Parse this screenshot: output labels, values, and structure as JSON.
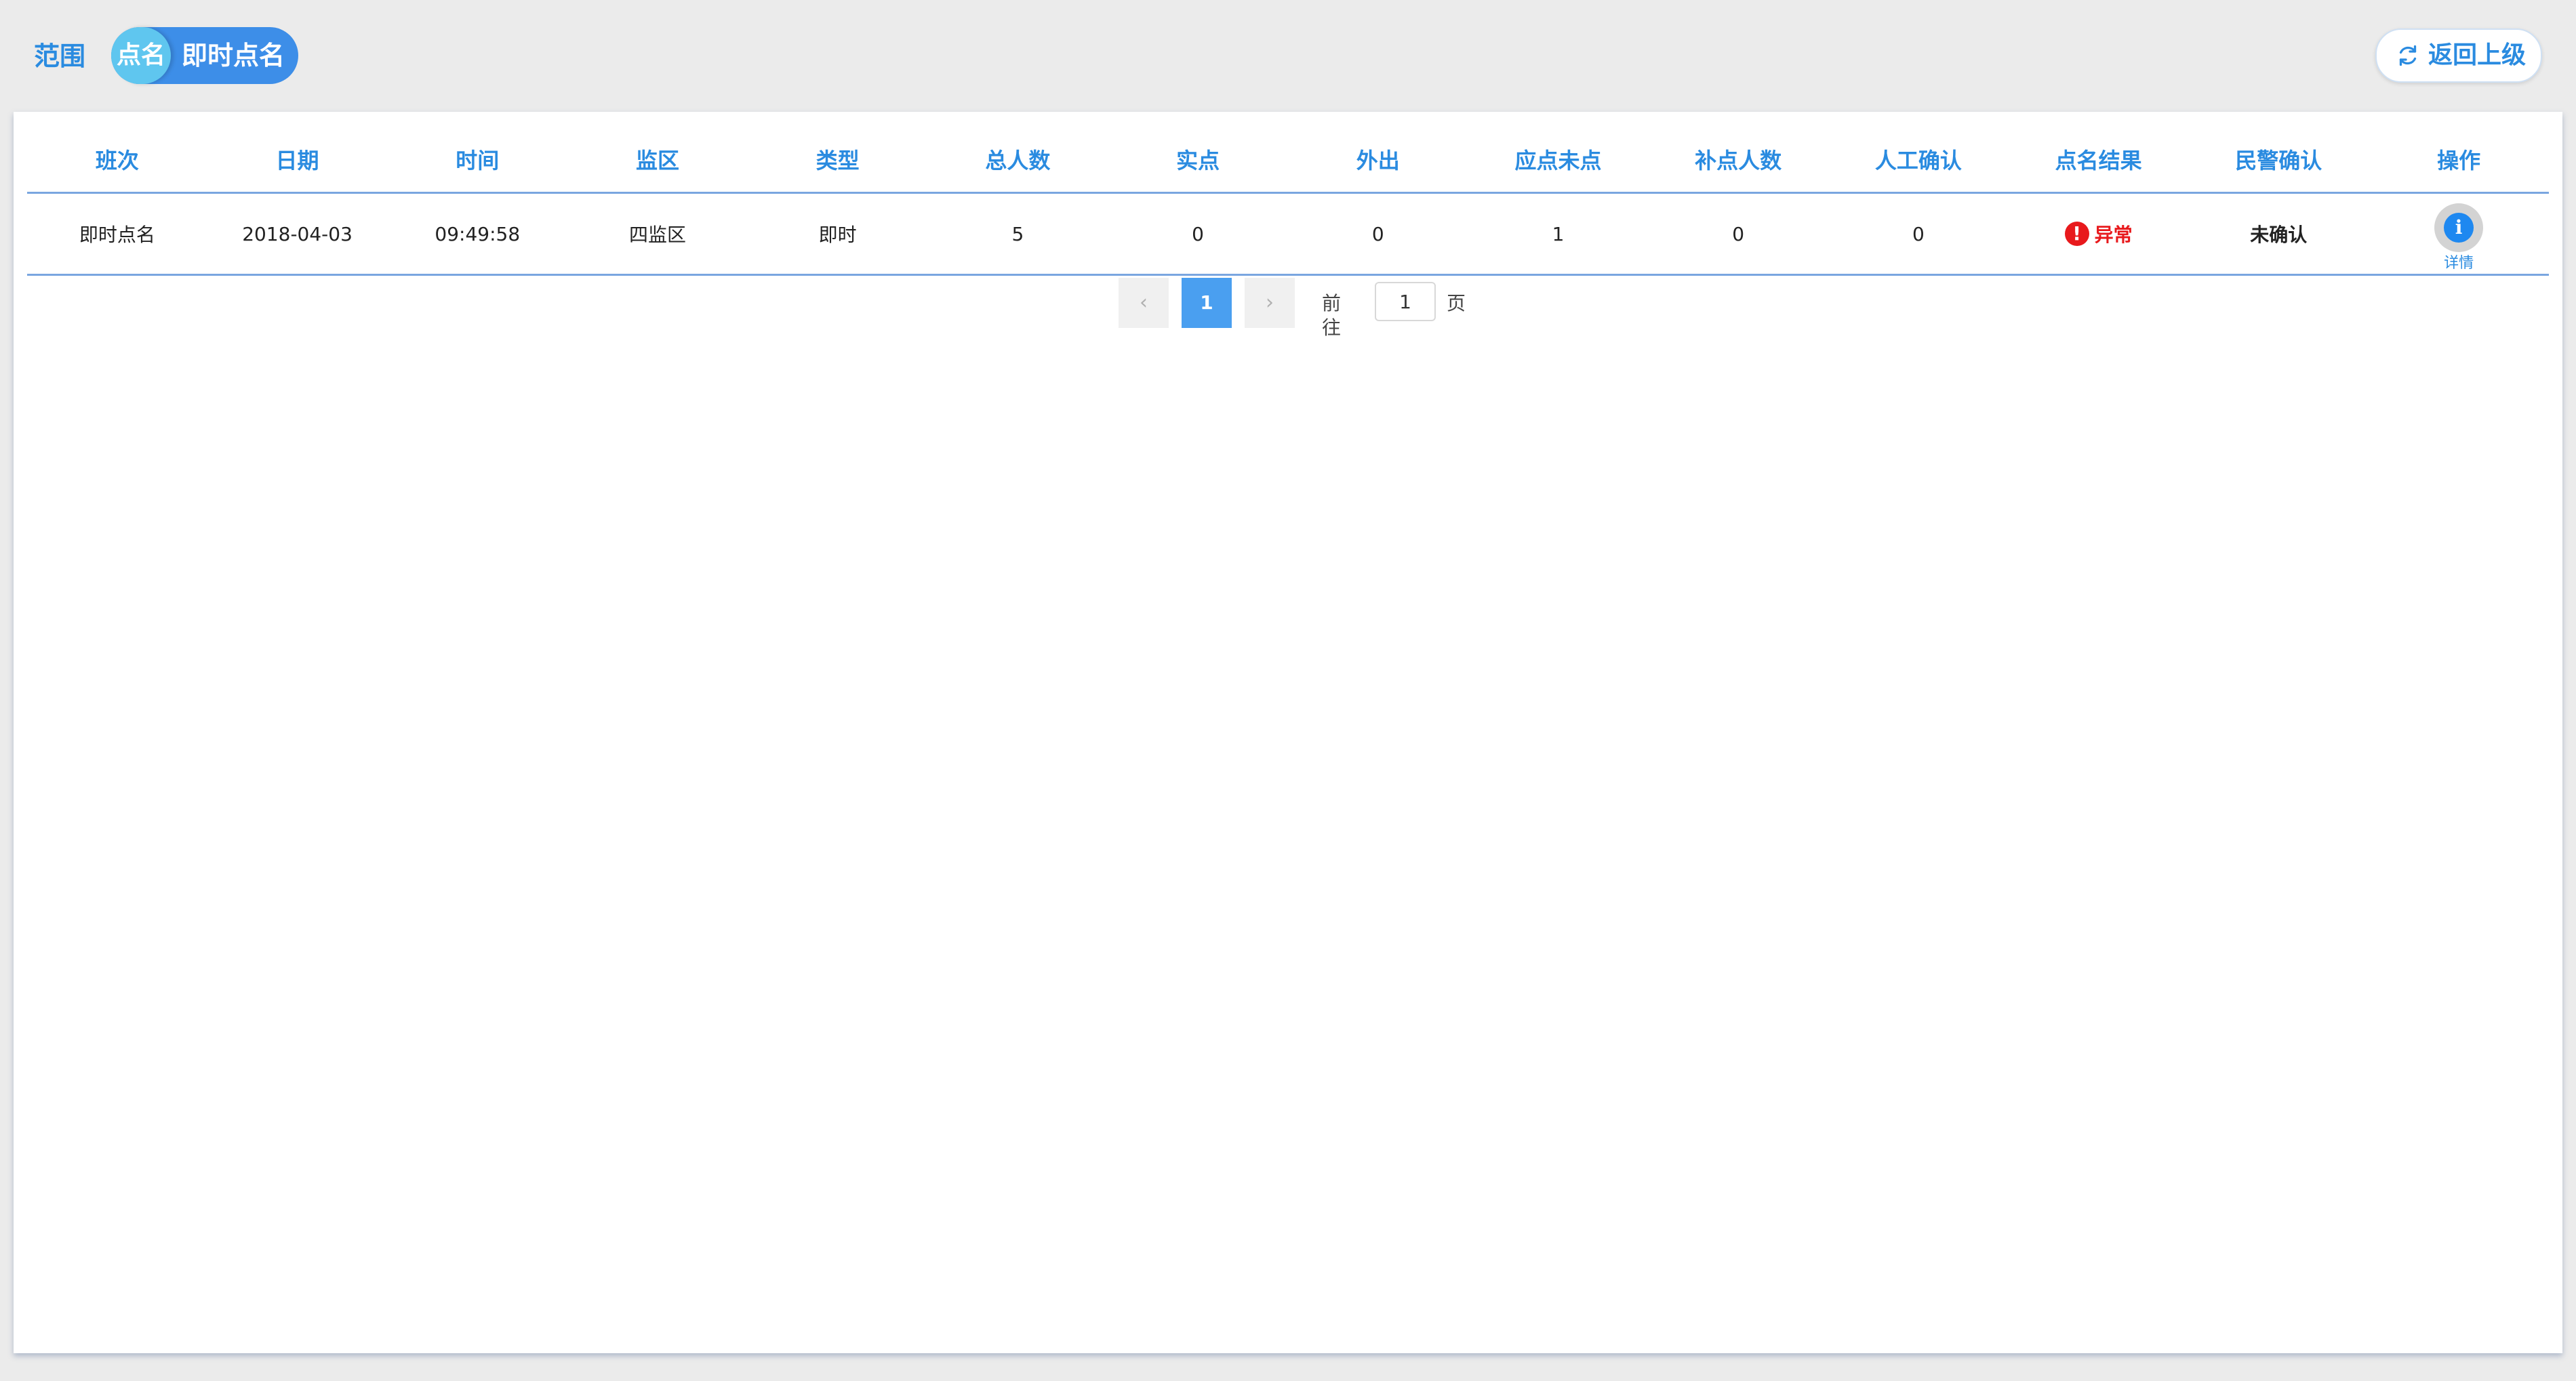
{
  "breadcrumb": {
    "scope": "范围",
    "parent": "点名",
    "current": "即时点名"
  },
  "header": {
    "back_label": "返回上级"
  },
  "table": {
    "columns": [
      "班次",
      "日期",
      "时间",
      "监区",
      "类型",
      "总人数",
      "实点",
      "外出",
      "应点未点",
      "补点人数",
      "人工确认",
      "点名结果",
      "民警确认",
      "操作"
    ],
    "rows": [
      {
        "shift": "即时点名",
        "date": "2018-04-03",
        "time": "09:49:58",
        "area": "四监区",
        "type": "即时",
        "total": "5",
        "present": "0",
        "out": "0",
        "missing": "1",
        "recheck": "0",
        "manual": "0",
        "result": "异常",
        "police_confirm": "未确认",
        "action": "详情",
        "action_icon": "info-icon"
      }
    ]
  },
  "pagination": {
    "current_page": "1",
    "goto_prefix": "前往",
    "goto_value": "1",
    "goto_suffix": "页"
  },
  "colors": {
    "accent": "#2a8be0",
    "danger": "#e8191c"
  }
}
